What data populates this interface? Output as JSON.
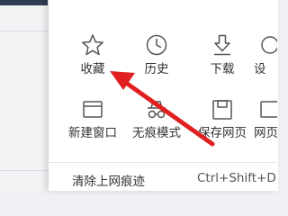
{
  "toolbar_items": [
    {
      "label": "收藏",
      "icon": "star-icon"
    },
    {
      "label": "历史",
      "icon": "clock-icon"
    },
    {
      "label": "下载",
      "icon": "download-icon"
    },
    {
      "label": "设",
      "icon": "settings-icon"
    },
    {
      "label": "新建窗口",
      "icon": "new-window-icon"
    },
    {
      "label": "无痕模式",
      "icon": "incognito-icon"
    },
    {
      "label": "保存网页",
      "icon": "save-page-icon"
    },
    {
      "label": "网页",
      "icon": "webpage-icon"
    }
  ],
  "menu": {
    "clear_history_label": "清除上网痕迹",
    "clear_history_shortcut": "Ctrl+Shift+D"
  },
  "colors": {
    "arrow": "#e02020",
    "icon_stroke": "#555555",
    "top_bar": "#2e3c4f"
  }
}
